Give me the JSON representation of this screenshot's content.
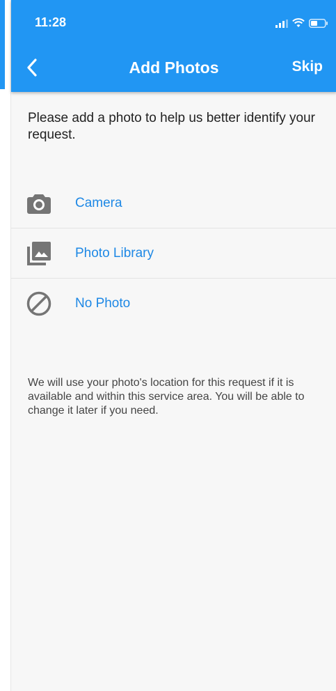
{
  "status_bar": {
    "time": "11:28",
    "icons": [
      "signal-icon",
      "wifi-icon",
      "battery-icon"
    ]
  },
  "header": {
    "back_icon": "chevron-left-icon",
    "title": "Add Photos",
    "skip_label": "Skip"
  },
  "prompt": "Please add a photo to help us better identify your request.",
  "options": [
    {
      "icon": "camera-icon",
      "label": "Camera"
    },
    {
      "icon": "photo-library-icon",
      "label": "Photo Library"
    },
    {
      "icon": "no-photo-icon",
      "label": "No Photo"
    }
  ],
  "footnote": "We will use your photo's location for this request if it is available and within this service area.  You will be able to change it later if you need.",
  "colors": {
    "primary": "#2196f3",
    "link": "#1e88e5",
    "icon_gray": "#757575",
    "background": "#f7f7f7"
  }
}
